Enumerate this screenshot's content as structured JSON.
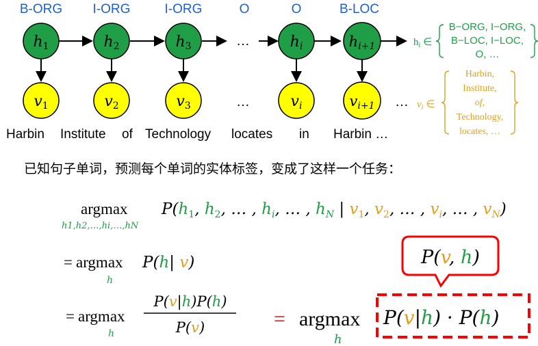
{
  "tags": [
    "B-ORG",
    "I-ORG",
    "I-ORG",
    "O",
    "O",
    "B-LOC"
  ],
  "hidden_nodes": [
    {
      "base": "h",
      "sub": "1"
    },
    {
      "base": "h",
      "sub": "2"
    },
    {
      "base": "h",
      "sub": "3"
    },
    {
      "base": "h",
      "sub": "i"
    },
    {
      "base": "h",
      "sub": "i+1"
    }
  ],
  "visible_nodes": [
    {
      "base": "v",
      "sub": "1"
    },
    {
      "base": "v",
      "sub": "2"
    },
    {
      "base": "v",
      "sub": "3"
    },
    {
      "base": "v",
      "sub": "i"
    },
    {
      "base": "v",
      "sub": "i+1"
    }
  ],
  "ellipsis": "…",
  "words": [
    "Harbin",
    "Institute",
    "of",
    "Technology",
    "locates",
    "in",
    "Harbin …"
  ],
  "hidden_set": {
    "prefix": "h",
    "prefix_sub": "i",
    "symbol": "∈",
    "lines": [
      "B−ORG, I−ORG,",
      "B−LOC, I−LOC,",
      "O, …"
    ]
  },
  "visible_set": {
    "prefix": "v",
    "prefix_sub": "i",
    "symbol": "∈",
    "lines": [
      "Harbin,",
      "Institute,",
      "of,",
      "Technology,",
      "locates, …"
    ]
  },
  "sentence_cn": "已知句子单词，预测每个单词的实体标签，变成了这样一个任务：",
  "formula": {
    "argmax": "argmax",
    "eq": "=",
    "line1_sub": "h1,h2,…,hi,…,hN",
    "callout": "P(v, h)",
    "final_sub": "h"
  },
  "colors": {
    "hidden_node": "#1f9d47",
    "visible_node": "#ffff00",
    "tag_blue": "#1f5fd0",
    "orange": "#e0a01e",
    "green": "#1f9d47",
    "red": "#ff0000"
  }
}
